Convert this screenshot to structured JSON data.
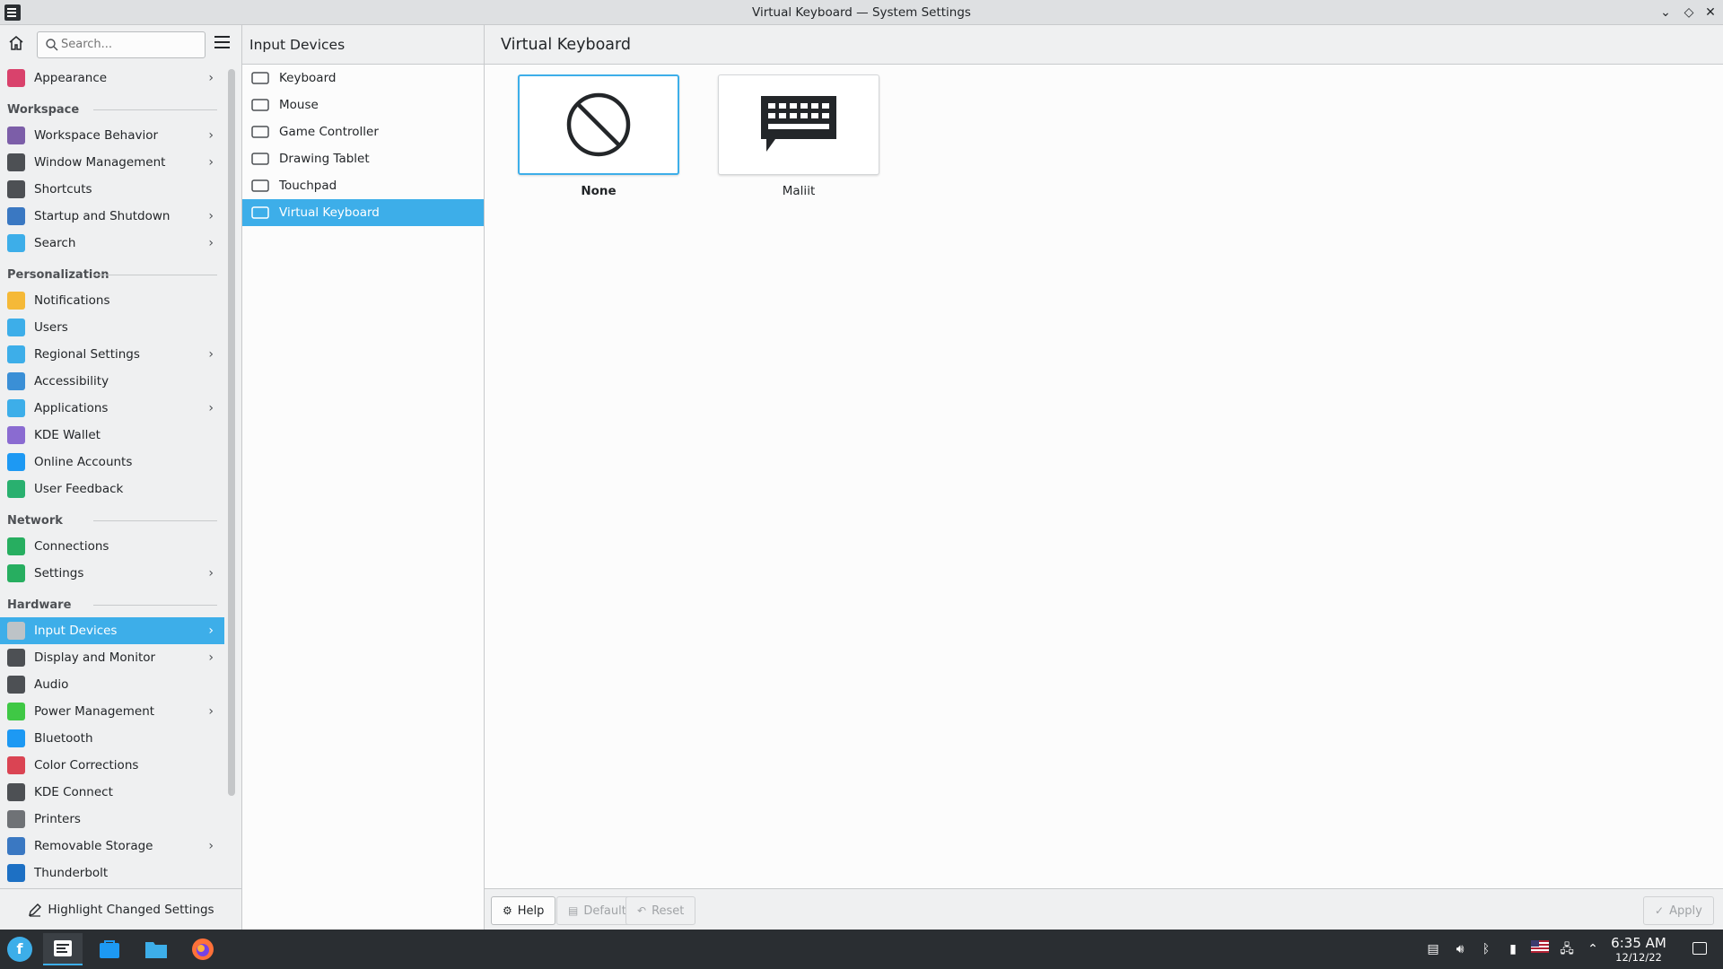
{
  "window": {
    "title": "Virtual Keyboard — System Settings",
    "controls": [
      "minimize",
      "maximize",
      "close"
    ]
  },
  "sidebar": {
    "search_placeholder": "Search...",
    "sections": [
      {
        "header": "",
        "items": [
          {
            "label": "Appearance",
            "icon": "appearance-icon",
            "has_children": true,
            "color": "#d9426c"
          }
        ]
      },
      {
        "header": "Workspace",
        "items": [
          {
            "label": "Workspace Behavior",
            "icon": "workspace-behavior-icon",
            "has_children": true,
            "color": "#7c5ea8"
          },
          {
            "label": "Window Management",
            "icon": "window-management-icon",
            "has_children": true,
            "color": "#4d5054"
          },
          {
            "label": "Shortcuts",
            "icon": "shortcuts-icon",
            "has_children": false,
            "color": "#4d5054"
          },
          {
            "label": "Startup and Shutdown",
            "icon": "startup-shutdown-icon",
            "has_children": true,
            "color": "#3a78c2"
          },
          {
            "label": "Search",
            "icon": "search-settings-icon",
            "has_children": true,
            "color": "#3daee9"
          }
        ]
      },
      {
        "header": "Personalization",
        "items": [
          {
            "label": "Notifications",
            "icon": "notifications-icon",
            "has_children": false,
            "color": "#f5b938"
          },
          {
            "label": "Users",
            "icon": "users-icon",
            "has_children": false,
            "color": "#3daee9"
          },
          {
            "label": "Regional Settings",
            "icon": "regional-settings-icon",
            "has_children": true,
            "color": "#3daee9"
          },
          {
            "label": "Accessibility",
            "icon": "accessibility-icon",
            "has_children": false,
            "color": "#3a8fd6"
          },
          {
            "label": "Applications",
            "icon": "applications-icon",
            "has_children": true,
            "color": "#3daee9"
          },
          {
            "label": "KDE Wallet",
            "icon": "kde-wallet-icon",
            "has_children": false,
            "color": "#8a6bd1"
          },
          {
            "label": "Online Accounts",
            "icon": "online-accounts-icon",
            "has_children": false,
            "color": "#1d99f3"
          },
          {
            "label": "User Feedback",
            "icon": "user-feedback-icon",
            "has_children": false,
            "color": "#29b06f"
          }
        ]
      },
      {
        "header": "Network",
        "items": [
          {
            "label": "Connections",
            "icon": "connections-icon",
            "has_children": false,
            "color": "#27ae60"
          },
          {
            "label": "Settings",
            "icon": "network-settings-icon",
            "has_children": true,
            "color": "#27ae60"
          }
        ]
      },
      {
        "header": "Hardware",
        "items": [
          {
            "label": "Input Devices",
            "icon": "input-devices-icon",
            "has_children": true,
            "color": "#bdc3c7",
            "active": true
          },
          {
            "label": "Display and Monitor",
            "icon": "display-monitor-icon",
            "has_children": true,
            "color": "#4d5054"
          },
          {
            "label": "Audio",
            "icon": "audio-icon",
            "has_children": false,
            "color": "#4d5054"
          },
          {
            "label": "Power Management",
            "icon": "power-management-icon",
            "has_children": true,
            "color": "#3fc845"
          },
          {
            "label": "Bluetooth",
            "icon": "bluetooth-icon",
            "has_children": false,
            "color": "#1d99f3"
          },
          {
            "label": "Color Corrections",
            "icon": "color-corrections-icon",
            "has_children": false,
            "color": "#da4453"
          },
          {
            "label": "KDE Connect",
            "icon": "kde-connect-icon",
            "has_children": false,
            "color": "#4d5054"
          },
          {
            "label": "Printers",
            "icon": "printers-icon",
            "has_children": false,
            "color": "#6f7276"
          },
          {
            "label": "Removable Storage",
            "icon": "removable-storage-icon",
            "has_children": true,
            "color": "#3a78c2"
          },
          {
            "label": "Thunderbolt",
            "icon": "thunderbolt-icon",
            "has_children": false,
            "color": "#1d70c4"
          }
        ]
      }
    ],
    "highlight_button": "Highlight Changed Settings"
  },
  "middle": {
    "title": "Input Devices",
    "items": [
      {
        "label": "Keyboard",
        "icon": "keyboard-icon"
      },
      {
        "label": "Mouse",
        "icon": "mouse-icon"
      },
      {
        "label": "Game Controller",
        "icon": "game-controller-icon"
      },
      {
        "label": "Drawing Tablet",
        "icon": "drawing-tablet-icon"
      },
      {
        "label": "Touchpad",
        "icon": "touchpad-icon"
      },
      {
        "label": "Virtual Keyboard",
        "icon": "virtual-keyboard-icon",
        "active": true
      }
    ]
  },
  "main": {
    "title": "Virtual Keyboard",
    "options": [
      {
        "label": "None",
        "icon": "none-icon",
        "selected": true
      },
      {
        "label": "Maliit",
        "icon": "maliit-keyboard-icon",
        "selected": false
      }
    ],
    "buttons": {
      "help": "Help",
      "defaults": "Defaults",
      "reset": "Reset",
      "apply": "Apply"
    }
  },
  "taskbar": {
    "time": "6:35 AM",
    "date": "12/12/22",
    "accent": "#3daee9"
  }
}
